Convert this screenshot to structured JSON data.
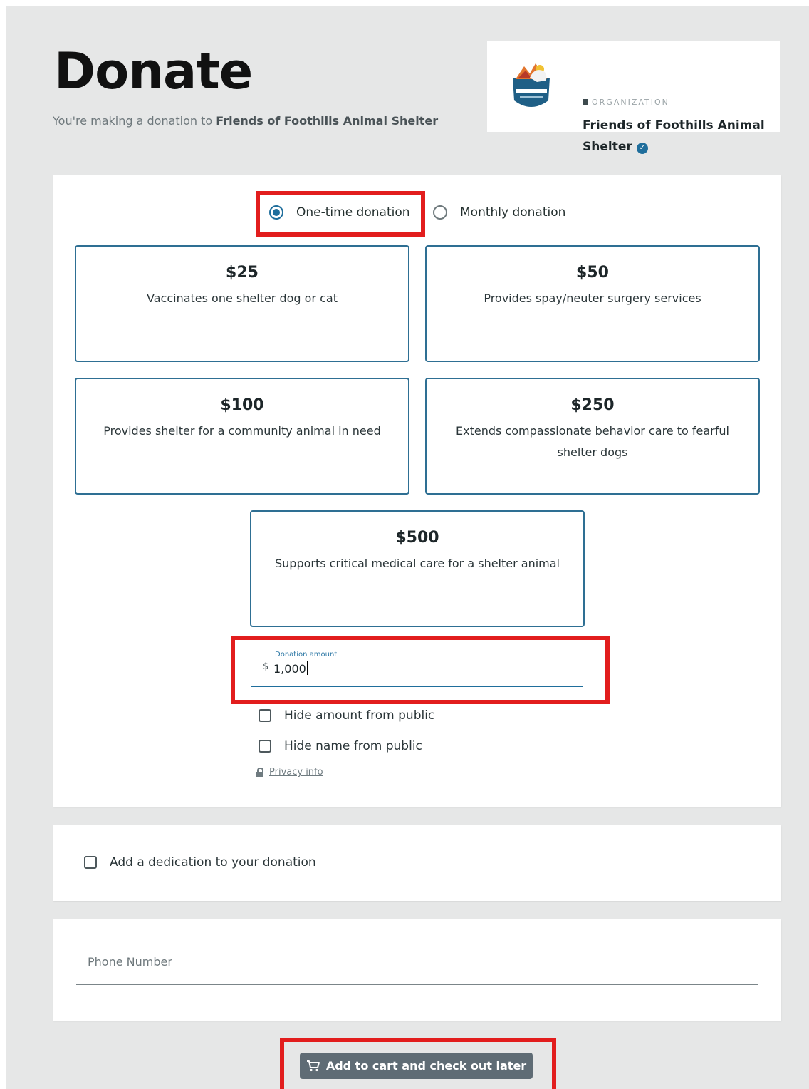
{
  "header": {
    "title": "Donate",
    "subtitle_prefix": "You're making a donation to ",
    "subtitle_org": "Friends of Foothills Animal Shelter"
  },
  "organization": {
    "tag": "ORGANIZATION",
    "name": "Friends of Foothills Animal Shelter",
    "verified_icon": "verified-badge-icon"
  },
  "frequency": {
    "options": [
      {
        "label": "One-time donation",
        "selected": true
      },
      {
        "label": "Monthly donation",
        "selected": false
      }
    ]
  },
  "amounts": [
    {
      "amount": "$25",
      "description": "Vaccinates one shelter dog or cat"
    },
    {
      "amount": "$50",
      "description": "Provides spay/neuter surgery services"
    },
    {
      "amount": "$100",
      "description": "Provides shelter for a community animal in need"
    },
    {
      "amount": "$250",
      "description": "Extends compassionate behavior care to fearful shelter dogs"
    },
    {
      "amount": "$500",
      "description": "Supports critical medical care for a shelter animal"
    }
  ],
  "donation_field": {
    "label": "Donation amount",
    "prefix": "$",
    "value": "1,000"
  },
  "options": {
    "hide_amount": "Hide amount from public",
    "hide_name": "Hide name from public",
    "privacy_link": "Privacy info"
  },
  "dedication": {
    "label": "Add a dedication to your donation"
  },
  "phone": {
    "placeholder": "Phone Number"
  },
  "cta": {
    "label": "Add to cart and check out later",
    "icon": "cart-icon"
  },
  "colors": {
    "accent": "#1f6e9c",
    "tile_border": "#2e6f93",
    "highlight": "#e21d1d",
    "button": "#5f6c75"
  }
}
